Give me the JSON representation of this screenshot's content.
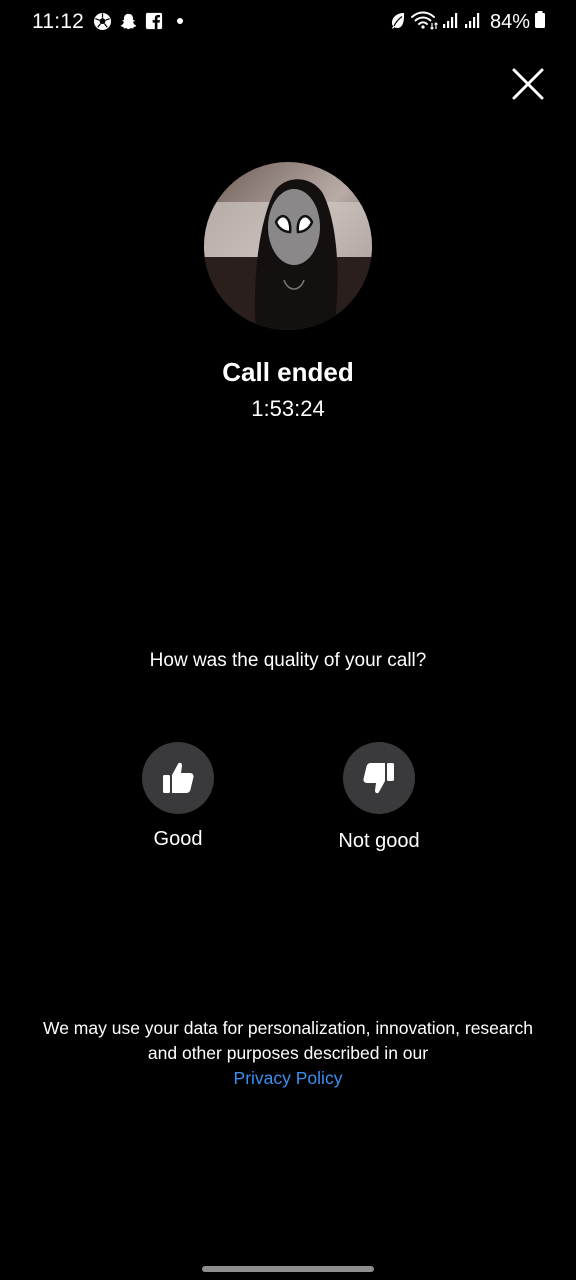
{
  "status_bar": {
    "time": "11:12",
    "left_icons": [
      "soccer-ball-icon",
      "snapchat-ghost-icon",
      "facebook-icon",
      "dot-icon"
    ],
    "right_icons": [
      "leaf-icon",
      "wifi-icon",
      "signal-icon",
      "signal-icon"
    ],
    "battery_percent": "84%"
  },
  "call": {
    "title": "Call ended",
    "duration": "1:53:24"
  },
  "feedback": {
    "question": "How was the quality of your call?",
    "good_label": "Good",
    "bad_label": "Not good"
  },
  "footer": {
    "disclaimer_line1": "We may use your data for personalization, innovation, research",
    "disclaimer_line2": "and other purposes described in our",
    "privacy_link": "Privacy Policy"
  },
  "colors": {
    "background": "#000000",
    "text": "#ffffff",
    "button_bg": "#3a3a3c",
    "link": "#3b8ff0"
  }
}
